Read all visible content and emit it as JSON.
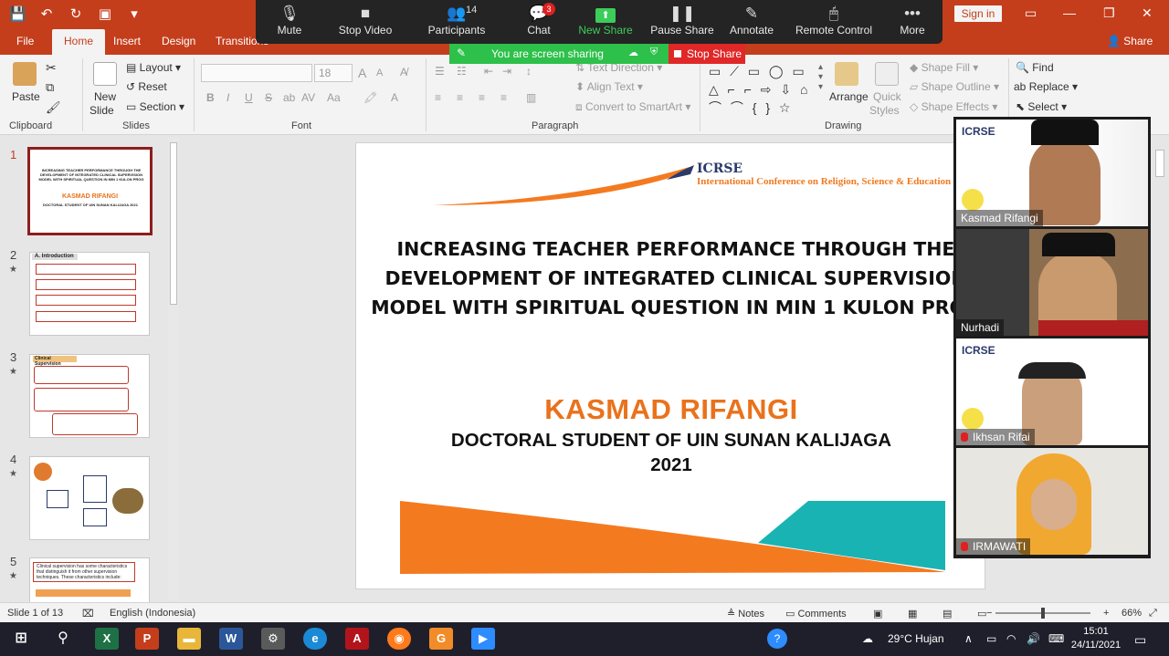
{
  "titlebar": {
    "qat": {
      "save": "💾",
      "undo": "↶",
      "redo": "↻",
      "present": "▣",
      "more": "▾"
    },
    "sign_in": "Sign in",
    "controls": {
      "ribbon_display": "▭",
      "minimize": "—",
      "restore": "❐",
      "close": "✕"
    }
  },
  "tabs": [
    "File",
    "Home",
    "Insert",
    "Design",
    "Transitions"
  ],
  "share": "Share",
  "ribbon": {
    "clipboard": {
      "paste": "Paste",
      "label": "Clipboard"
    },
    "slides": {
      "new_slide": "New",
      "new_slide2": "Slide",
      "layout": "Layout",
      "reset": "Reset",
      "section": "Section",
      "label": "Slides"
    },
    "font": {
      "size": "18",
      "label": "Font",
      "bold": "B",
      "italic": "I",
      "underline": "U",
      "strike": "S",
      "aa": "Aa",
      "grow": "A",
      "shrink": "A"
    },
    "paragraph": {
      "text_direction": "Text Direction",
      "align_text": "Align Text",
      "smartart": "Convert to SmartArt",
      "label": "Paragraph"
    },
    "drawing": {
      "arrange": "Arrange",
      "quick_styles": "Quick",
      "quick_styles2": "Styles",
      "shape_fill": "Shape Fill",
      "shape_outline": "Shape Outline",
      "shape_effects": "Shape Effects",
      "label": "Drawing"
    },
    "editing": {
      "find": "Find",
      "replace": "Replace",
      "select": "Select"
    }
  },
  "zoom": {
    "mute": "Mute",
    "stop_video": "Stop Video",
    "participants": "Participants",
    "participants_count": "14",
    "chat": "Chat",
    "chat_badge": "3",
    "new_share": "New Share",
    "pause_share": "Pause Share",
    "annotate": "Annotate",
    "remote_control": "Remote Control",
    "more": "More",
    "sharing_text": "You are screen sharing",
    "stop_share": "Stop Share"
  },
  "thumbnails": [
    {
      "num": "1",
      "star": ""
    },
    {
      "num": "2",
      "star": "★",
      "heading": "A. Introduction"
    },
    {
      "num": "3",
      "star": "★",
      "heading": "Clinical Supervision"
    },
    {
      "num": "4",
      "star": "★"
    },
    {
      "num": "5",
      "star": "★"
    }
  ],
  "thumb1": {
    "title": "INCREASING TEACHER PERFORMANCE THROUGH THE DEVELOPMENT OF INTEGRATED CLINICAL SUPERVISION MODEL WITH SPIRITUAL QUESTION IN MIN 1 KULON PROG",
    "name": "KASMAD RIFANGI",
    "sub": "DOCTORAL STUDENT OF UIN SUNAN KALIJAGA 2021"
  },
  "thumb5_text": "Clinical supervision has some characteristics that distinguish it from other supervision techniques. These characteristics include:",
  "slide": {
    "logo": "ICRSE",
    "conference": "International Conference on Religion, Science & Education",
    "title_lines": [
      "INCREASING TEACHER PERFORMANCE THROUGH THE",
      "DEVELOPMENT OF INTEGRATED CLINICAL SUPERVISION",
      "MODEL WITH SPIRITUAL QUESTION IN MIN 1 KULON PROG"
    ],
    "name": "KASMAD RIFANGI",
    "subtitle": "DOCTORAL STUDENT OF UIN SUNAN KALIJAGA",
    "year": "2021",
    "colors": {
      "orange": "#f47a20",
      "teal": "#1ab3b3",
      "navy": "#2a3a6a"
    }
  },
  "video_tiles": [
    {
      "name": "Kasmad Rifangi",
      "muted": false
    },
    {
      "name": "Nurhadi",
      "muted": false
    },
    {
      "name": "Ikhsan Rifai",
      "muted": true
    },
    {
      "name": "IRMAWATI",
      "muted": true
    }
  ],
  "statusbar": {
    "slide_info": "Slide 1 of 13",
    "language": "English (Indonesia)",
    "notes": "Notes",
    "comments": "Comments",
    "minus": "−",
    "plus": "+",
    "zoom": "66%"
  },
  "taskbar": {
    "weather": "29°C Hujan",
    "time": "15:01",
    "date": "24/11/2021"
  }
}
